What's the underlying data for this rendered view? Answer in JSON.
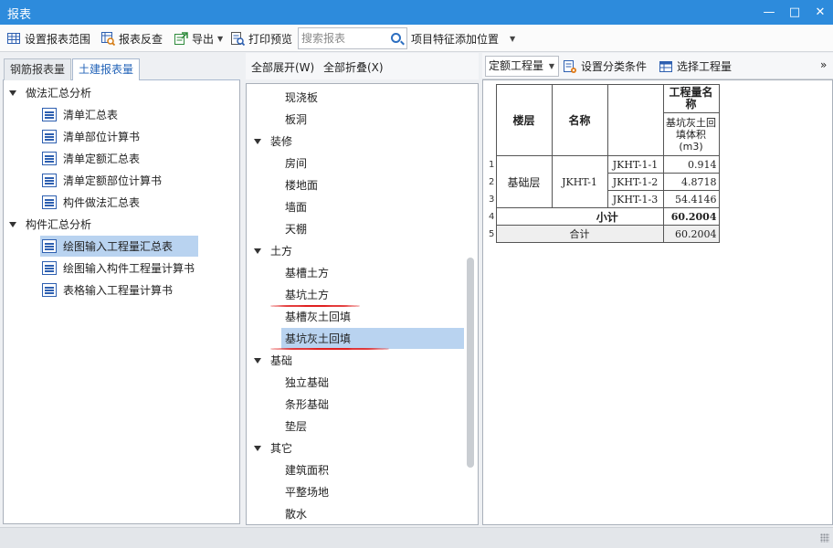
{
  "window": {
    "title": "报表",
    "minimize": "—",
    "maximize": "□",
    "close": "✕"
  },
  "toolbar": {
    "set_range": "设置报表范围",
    "reverse_check": "报表反查",
    "export": "导出",
    "print_preview": "打印预览",
    "search_placeholder": "搜索报表",
    "feature_position": "项目特征添加位置"
  },
  "left_tabs": {
    "rebar": "钢筋报表量",
    "civil": "土建报表量"
  },
  "left_tree": {
    "group1": "做法汇总分析",
    "group1_items": [
      "清单汇总表",
      "清单部位计算书",
      "清单定额汇总表",
      "清单定额部位计算书",
      "构件做法汇总表"
    ],
    "group2": "构件汇总分析",
    "group2_items": [
      "绘图输入工程量汇总表",
      "绘图输入构件工程量计算书",
      "表格输入工程量计算书"
    ]
  },
  "middle": {
    "expand_all": "全部展开(W)",
    "collapse_all": "全部折叠(X)",
    "rows": [
      {
        "label": "现浇板",
        "level": 2
      },
      {
        "label": "板洞",
        "level": 2
      },
      {
        "label": "装修",
        "level": 1
      },
      {
        "label": "房间",
        "level": 2
      },
      {
        "label": "楼地面",
        "level": 2
      },
      {
        "label": "墙面",
        "level": 2
      },
      {
        "label": "天棚",
        "level": 2
      },
      {
        "label": "土方",
        "level": 1
      },
      {
        "label": "基槽土方",
        "level": 2
      },
      {
        "label": "基坑土方",
        "level": 2
      },
      {
        "label": "基槽灰土回填",
        "level": 2
      },
      {
        "label": "基坑灰土回填",
        "level": 2
      },
      {
        "label": "基础",
        "level": 1
      },
      {
        "label": "独立基础",
        "level": 2
      },
      {
        "label": "条形基础",
        "level": 2
      },
      {
        "label": "垫层",
        "level": 2
      },
      {
        "label": "其它",
        "level": 1
      },
      {
        "label": "建筑面积",
        "level": 2
      },
      {
        "label": "平整场地",
        "level": 2
      },
      {
        "label": "散水",
        "level": 2
      }
    ]
  },
  "right_toolbar": {
    "quota_select": "定额工程量",
    "set_category": "设置分类条件",
    "select_quantity": "选择工程量",
    "more": "»"
  },
  "report": {
    "col_floor": "楼层",
    "col_name": "名称",
    "col_qty_name": "工程量名称",
    "col_qty_sub": "基坑灰土回填体积(m3)",
    "floor": "基础层",
    "name": "JKHT-1",
    "rows": [
      {
        "num": "1",
        "id": "JKHT-1-1",
        "value": "0.914"
      },
      {
        "num": "2",
        "id": "JKHT-1-2",
        "value": "4.8718"
      },
      {
        "num": "3",
        "id": "JKHT-1-3",
        "value": "54.4146"
      }
    ],
    "subtotal_num": "4",
    "subtotal_label": "小计",
    "subtotal_value": "60.2004",
    "total_num": "5",
    "total_label": "合计",
    "total_value": "60.2004"
  }
}
